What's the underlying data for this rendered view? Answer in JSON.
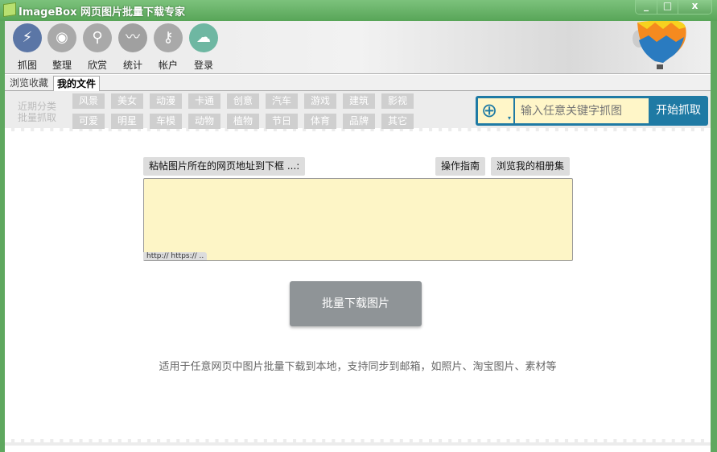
{
  "window": {
    "title": "ImageBox 网页图片批量下载专家",
    "minimize": "_",
    "maximize": "□",
    "close": "x"
  },
  "toolbar": [
    {
      "label": "抓图",
      "icon": "lightning-icon",
      "color": "#5b76a6",
      "glyph": "⚡"
    },
    {
      "label": "整理",
      "icon": "eye-icon",
      "color": "#a9a9a9",
      "glyph": "◉"
    },
    {
      "label": "欣赏",
      "icon": "magnifier-icon",
      "color": "#a9a9a9",
      "glyph": "⚲"
    },
    {
      "label": "统计",
      "icon": "stats-icon",
      "color": "#a0a0a0",
      "glyph": "〰"
    },
    {
      "label": "帐户",
      "icon": "key-icon",
      "color": "#a9a9a9",
      "glyph": "⚷"
    },
    {
      "label": "登录",
      "icon": "cloud-upload-icon",
      "color": "#6eb7a2",
      "glyph": "☁"
    }
  ],
  "tabs": [
    "浏览收藏",
    "我的文件"
  ],
  "categories": {
    "label1": "近期分类",
    "label2": "批量抓取",
    "row1": [
      "风景",
      "美女",
      "动漫",
      "卡通",
      "创意",
      "汽车",
      "游戏",
      "建筑",
      "影视"
    ],
    "row2": [
      "可爱",
      "明星",
      "车模",
      "动物",
      "植物",
      "节日",
      "体育",
      "品牌",
      "其它"
    ]
  },
  "search": {
    "placeholder": "输入任意关键字抓图",
    "button": "开始抓取",
    "accent": "#1f7aa4"
  },
  "main": {
    "paste_label": "粘帖图片所在的网页地址到下框 ...:",
    "guide": "操作指南",
    "album": "浏览我的相册集",
    "url_hint": "http:// https:// ..",
    "download": "批量下载图片",
    "description": "适用于任意网页中图片批量下载到本地，支持同步到邮箱，如照片、淘宝图片、素材等"
  }
}
